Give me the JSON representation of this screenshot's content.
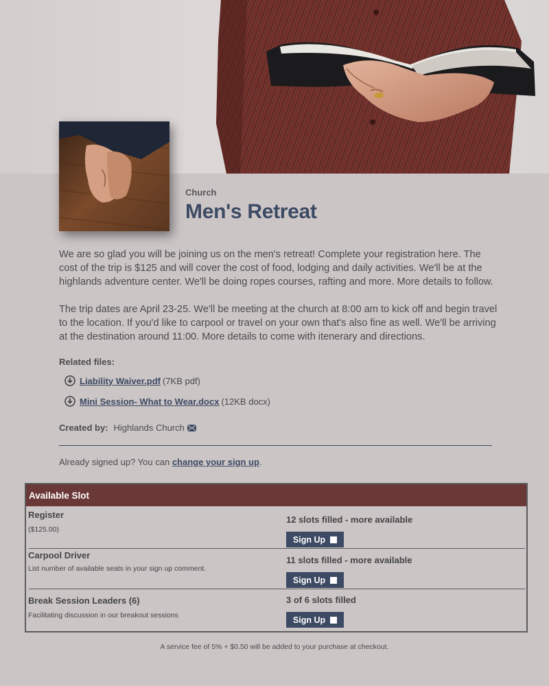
{
  "header": {
    "category": "Church",
    "title": "Men's Retreat"
  },
  "description": {
    "paragraph1": "We are so glad you will be joining us on the men's retreat! Complete your registration here. The cost of the trip is $125 and will cover the cost of food, lodging and daily activities. We'll be at the highlands adventure center. We'll be doing ropes courses, rafting and more. More details to follow.",
    "paragraph2": "The trip dates are April 23-25. We'll be meeting at the church at 8:00 am to kick off and begin travel to the location. If you'd like to carpool or travel on your own that's also fine as well. We'll be arriving at the destination around 11:00. More details to come with itenerary and directions."
  },
  "related_files": {
    "label": "Related files:",
    "files": [
      {
        "name": " Liability Waiver.pdf ",
        "meta": "(7KB pdf)",
        "icon": "download-icon"
      },
      {
        "name": " Mini Session- What to Wear.docx ",
        "meta": "(12KB docx)",
        "icon": "download-icon"
      }
    ]
  },
  "created_by": {
    "label": "Created by:",
    "value": "Highlands Church",
    "icon": "mail-icon"
  },
  "already": {
    "prefix": "Already signed up? You can ",
    "link": "change your sign up",
    "suffix": "."
  },
  "slots": {
    "header": "Available Slot",
    "button_label": "Sign Up",
    "rows": [
      {
        "name": "Register",
        "sub": "($125.00)",
        "status": "12 slots filled - more available"
      },
      {
        "name": "Carpool Driver",
        "sub": "List number of available seats in your sign up comment.",
        "status": "11 slots filled - more available"
      },
      {
        "name": "Break Session Leaders (6)",
        "sub": "Facilitating discussion in our breakout sessions",
        "status": "3 of 6 slots filled"
      }
    ]
  },
  "fee_note": "A service fee of 5% + $0.50 will be added to your purchase at checkout.",
  "colors": {
    "page_bg": "#cbc5c6",
    "accent_navy": "#3d4a63",
    "slot_header": "#6b3838"
  }
}
